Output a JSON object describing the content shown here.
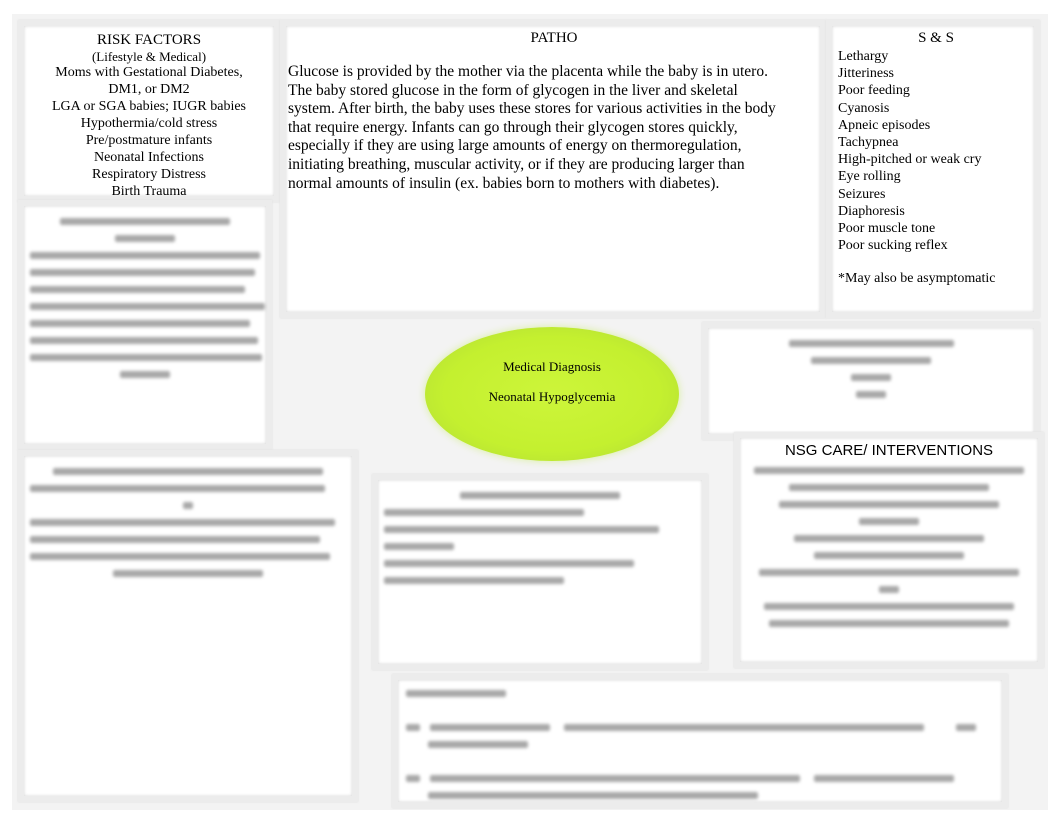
{
  "risk_factors": {
    "title": "RISK FACTORS",
    "subtitle": "(Lifestyle & Medical)",
    "items": [
      "Moms with Gestational Diabetes,",
      "DM1, or DM2",
      "LGA or SGA babies; IUGR babies",
      "Hypothermia/cold stress",
      "Pre/postmature infants",
      "Neonatal Infections",
      "Respiratory Distress",
      "Birth Trauma"
    ]
  },
  "patho": {
    "title": "PATHO",
    "text": "Glucose is provided by the mother via the placenta while the baby is in utero. The baby stored glucose in the form of glycogen in the liver and skeletal system. After birth, the baby uses these stores for various activities in the body that require energy. Infants can go through their glycogen stores quickly, especially if they are using large amounts of energy on thermoregulation, initiating breathing, muscular activity, or if they are producing larger than normal amounts of insulin (ex. babies born to mothers with diabetes)."
  },
  "signs_symptoms": {
    "title": "S & S",
    "items": [
      "Lethargy",
      "Jitteriness",
      "Poor feeding",
      "Cyanosis",
      "Apneic episodes",
      "Tachypnea",
      "High-pitched or weak cry",
      "Eye rolling",
      "Seizures",
      "Diaphoresis",
      "Poor muscle tone",
      "Poor sucking reflex"
    ],
    "note": "*May also be asymptomatic"
  },
  "diagnosis": {
    "label": "Medical Diagnosis",
    "value": "Neonatal Hypoglycemia"
  },
  "nsg_care": {
    "title": "NSG CARE/ INTERVENTIONS"
  },
  "colors": {
    "diagnosis_fill": "#c4f02f",
    "box_border": "#ececec",
    "background": "#f3f3f3"
  }
}
